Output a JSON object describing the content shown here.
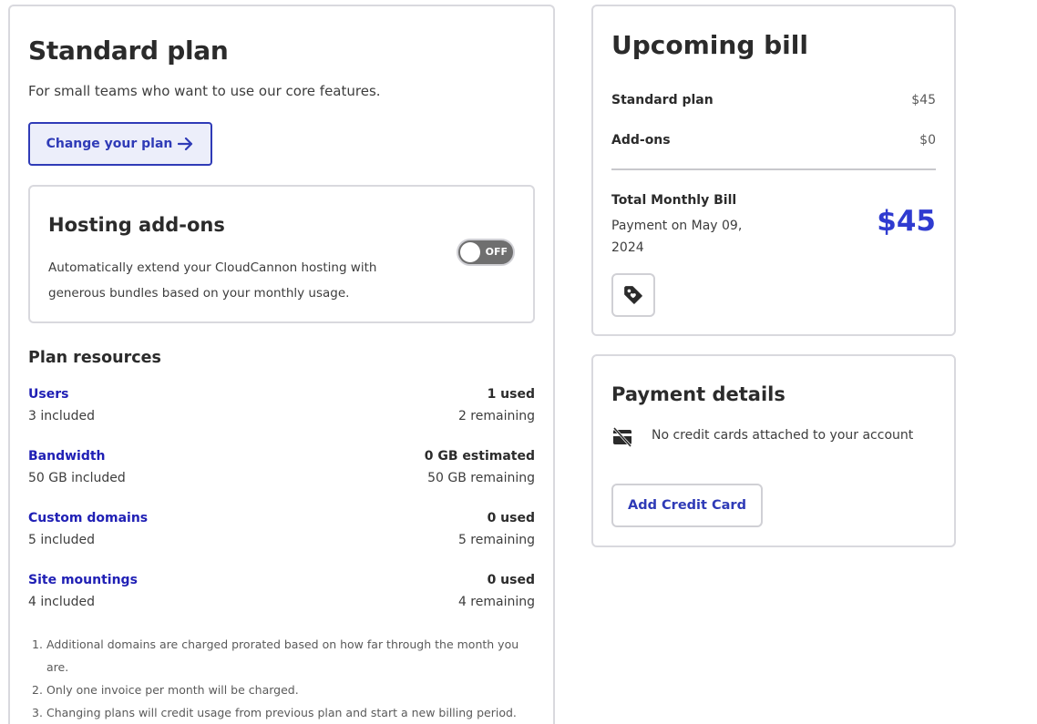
{
  "plan": {
    "title": "Standard plan",
    "description": "For small teams who want to use our core features.",
    "change_button": "Change your plan"
  },
  "addons": {
    "title": "Hosting add-ons",
    "description": "Automatically extend your CloudCannon hosting with generous bundles based on your monthly usage.",
    "toggle_label": "OFF",
    "toggle_on": false
  },
  "resources": {
    "title": "Plan resources",
    "items": [
      {
        "name": "Users",
        "included": "3 included",
        "used": "1 used",
        "remaining": "2 remaining"
      },
      {
        "name": "Bandwidth",
        "included": "50 GB included",
        "used": "0 GB estimated",
        "remaining": "50 GB remaining"
      },
      {
        "name": "Custom domains",
        "included": "5 included",
        "used": "0 used",
        "remaining": "5 remaining"
      },
      {
        "name": "Site mountings",
        "included": "4 included",
        "used": "0 used",
        "remaining": "4 remaining"
      }
    ],
    "notes": [
      {
        "num": "1.",
        "text": "Additional domains are charged prorated based on how far through the month you are."
      },
      {
        "num": "2.",
        "text": "Only one invoice per month will be charged."
      },
      {
        "num": "3.",
        "text": "Changing plans will credit usage from previous plan and start a new billing period."
      }
    ]
  },
  "bill": {
    "title": "Upcoming bill",
    "plan_label": "Standard plan",
    "plan_amount": "$45",
    "addons_label": "Add-ons",
    "addons_amount": "$0",
    "total_label": "Total Monthly Bill",
    "payment_date": "Payment on May 09, 2024",
    "total_amount": "$45",
    "accent_color": "#2f3bd0"
  },
  "payment": {
    "title": "Payment details",
    "no_cards_text": "No credit cards attached to your account",
    "add_card_button": "Add Credit Card"
  },
  "icons": {
    "change_plan": "arrow-right-icon",
    "coupon": "tag-icon",
    "no_card": "credit-card-off-icon"
  }
}
